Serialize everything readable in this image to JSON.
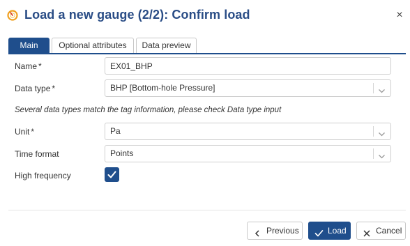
{
  "dialog": {
    "title": "Load a new gauge (2/2): Confirm load",
    "icon": "gauge-icon",
    "close_label": "×"
  },
  "tabs": [
    {
      "label": "Main",
      "active": true
    },
    {
      "label": "Optional attributes",
      "active": false
    },
    {
      "label": "Data preview",
      "active": false
    }
  ],
  "form": {
    "name": {
      "label": "Name",
      "required_mark": "*",
      "value": "EX01_BHP"
    },
    "data_type": {
      "label": "Data type",
      "required_mark": "*",
      "value": "BHP [Bottom-hole Pressure]"
    },
    "info": "Several data types match the tag information, please check Data type input",
    "unit": {
      "label": "Unit",
      "required_mark": "*",
      "value": "Pa"
    },
    "time_format": {
      "label": "Time format",
      "value": "Points"
    },
    "high_frequency": {
      "label": "High frequency",
      "checked": true
    }
  },
  "footer": {
    "previous_label": "Previous",
    "load_label": "Load",
    "cancel_label": "Cancel"
  },
  "colors": {
    "accent": "#1f4e8c",
    "title": "#2a4d86",
    "icon_orange": "#f0a020",
    "icon_red": "#d9452b"
  }
}
